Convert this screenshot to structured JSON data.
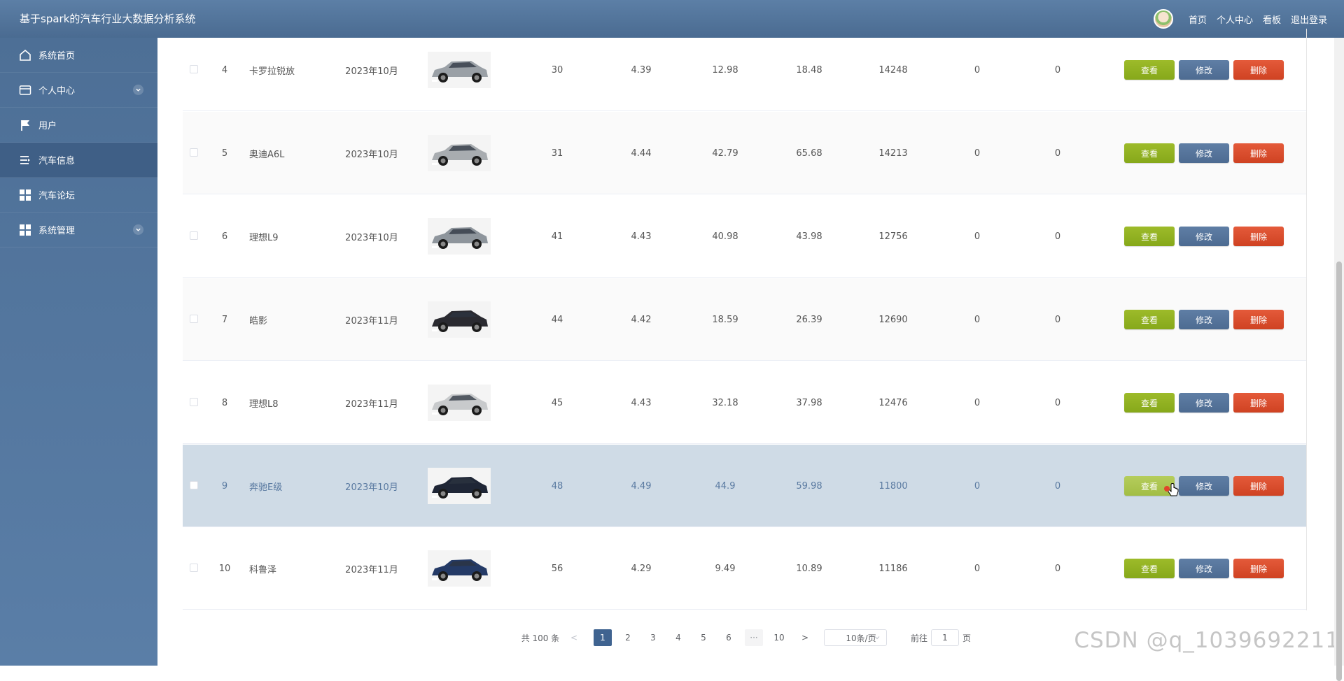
{
  "header": {
    "title": "基于spark的汽车行业大数据分析系统",
    "nav": [
      "首页",
      "个人中心",
      "看板",
      "退出登录"
    ]
  },
  "sidebar": {
    "items": [
      {
        "label": "系统首页",
        "icon": "home-icon"
      },
      {
        "label": "个人中心",
        "icon": "card-icon",
        "expandable": true
      },
      {
        "label": "用户",
        "icon": "flag-icon"
      },
      {
        "label": "汽车信息",
        "icon": "list-icon",
        "active": true
      },
      {
        "label": "汽车论坛",
        "icon": "grid-icon"
      },
      {
        "label": "系统管理",
        "icon": "grid-icon",
        "expandable": true
      }
    ]
  },
  "table": {
    "rows": [
      {
        "idx": "4",
        "name": "卡罗拉锐放",
        "date": "2023年10月",
        "a": "30",
        "b": "4.39",
        "c": "12.98",
        "d": "18.48",
        "e": "14248",
        "f": "0",
        "g": "0",
        "car_color": "#9aa0a6"
      },
      {
        "idx": "5",
        "name": "奥迪A6L",
        "date": "2023年10月",
        "a": "31",
        "b": "4.44",
        "c": "42.79",
        "d": "65.68",
        "e": "14213",
        "f": "0",
        "g": "0",
        "car_color": "#a8acb0"
      },
      {
        "idx": "6",
        "name": "理想L9",
        "date": "2023年10月",
        "a": "41",
        "b": "4.43",
        "c": "40.98",
        "d": "43.98",
        "e": "12756",
        "f": "0",
        "g": "0",
        "car_color": "#8e959c"
      },
      {
        "idx": "7",
        "name": "皓影",
        "date": "2023年11月",
        "a": "44",
        "b": "4.42",
        "c": "18.59",
        "d": "26.39",
        "e": "12690",
        "f": "0",
        "g": "0",
        "car_color": "#2a2a30"
      },
      {
        "idx": "8",
        "name": "理想L8",
        "date": "2023年11月",
        "a": "45",
        "b": "4.43",
        "c": "32.18",
        "d": "37.98",
        "e": "12476",
        "f": "0",
        "g": "0",
        "car_color": "#c8cacc"
      },
      {
        "idx": "9",
        "name": "奔驰E级",
        "date": "2023年10月",
        "a": "48",
        "b": "4.49",
        "c": "44.9",
        "d": "59.98",
        "e": "11800",
        "f": "0",
        "g": "0",
        "car_color": "#1f2636"
      },
      {
        "idx": "10",
        "name": "科鲁泽",
        "date": "2023年11月",
        "a": "56",
        "b": "4.29",
        "c": "9.49",
        "d": "10.89",
        "e": "11186",
        "f": "0",
        "g": "0",
        "car_color": "#243a66"
      }
    ],
    "actions": {
      "view": "查看",
      "edit": "修改",
      "delete": "删除"
    }
  },
  "pagination": {
    "total_text": "共 100 条",
    "prev": "<",
    "pages": [
      "1",
      "2",
      "3",
      "4",
      "5",
      "6"
    ],
    "more": "···",
    "last": "10",
    "next": ">",
    "page_size": "10条/页",
    "goto_label": "前往",
    "goto_value": "1",
    "goto_unit": "页"
  },
  "watermark": "CSDN @q_1039692211",
  "colors": {
    "header": "#4f7198",
    "sidebar": "#5378a0",
    "view": "#93b521",
    "edit": "#56759c",
    "delete": "#d94b2b",
    "active_page": "#3f6390"
  }
}
